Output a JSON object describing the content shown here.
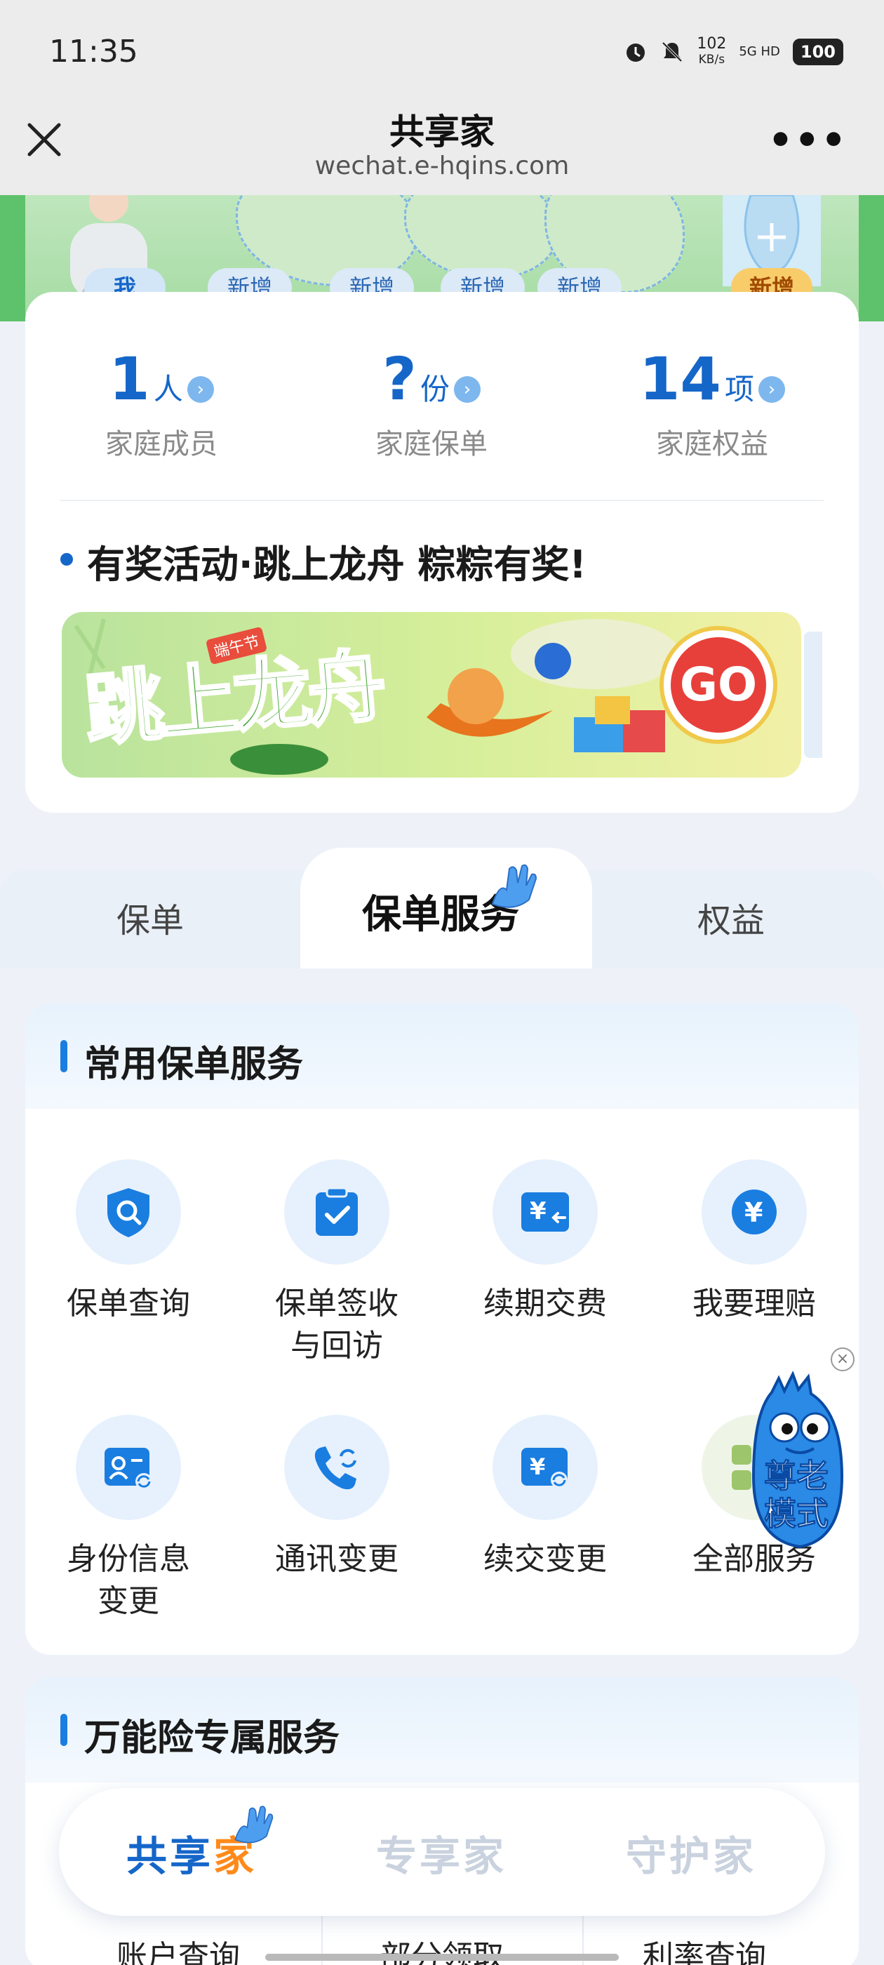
{
  "status_bar": {
    "time": "11:35",
    "net_speed": "102",
    "net_unit": "KB/s",
    "signal": "5G HD",
    "battery": "100"
  },
  "titlebar": {
    "title": "共享家",
    "subtitle": "wechat.e-hqins.com",
    "close_icon": "close-icon",
    "more_icon": "more-icon"
  },
  "family": {
    "member_tags": [
      "我",
      "新增",
      "新增",
      "新增",
      "新增",
      "新增"
    ],
    "stats": [
      {
        "num": "1",
        "unit": "人",
        "label": "家庭成员"
      },
      {
        "num": "?",
        "unit": "份",
        "label": "家庭保单"
      },
      {
        "num": "14",
        "unit": "项",
        "label": "家庭权益"
      }
    ],
    "activity_title": "有奖活动·跳上龙舟 粽粽有奖!",
    "promo": {
      "title": "跳上龙舟",
      "tag": "端午节",
      "go": "GO"
    }
  },
  "tabs": [
    {
      "label": "保单"
    },
    {
      "label": "保单服务"
    },
    {
      "label": "权益"
    }
  ],
  "common_services": {
    "title": "常用保单服务",
    "items": [
      {
        "label": "保单查询",
        "icon": "shield-search-icon"
      },
      {
        "label": "保单签收\n与回访",
        "icon": "clipboard-check-icon"
      },
      {
        "label": "续期交费",
        "icon": "yen-card-icon"
      },
      {
        "label": "我要理赔",
        "icon": "yen-coin-icon"
      },
      {
        "label": "身份信息\n变更",
        "icon": "id-card-refresh-icon"
      },
      {
        "label": "通讯变更",
        "icon": "phone-refresh-icon"
      },
      {
        "label": "续交变更",
        "icon": "yen-refresh-icon"
      },
      {
        "label": "全部服务",
        "icon": "all-services-icon"
      }
    ]
  },
  "mascot": {
    "label_line1": "尊老",
    "label_line2": "模式",
    "close": "×"
  },
  "universal_services": {
    "title": "万能险专属服务",
    "items": [
      "账户查询",
      "部分领取",
      "利率查询"
    ]
  },
  "bottom_nav": {
    "items": [
      {
        "main": "共享",
        "alt": "家"
      },
      {
        "main": "专享家",
        "alt": ""
      },
      {
        "main": "守护家",
        "alt": ""
      }
    ]
  },
  "colors": {
    "accent": "#1566c9",
    "accent_light": "#e6f1fd",
    "highlight": "#ff8a1a"
  }
}
